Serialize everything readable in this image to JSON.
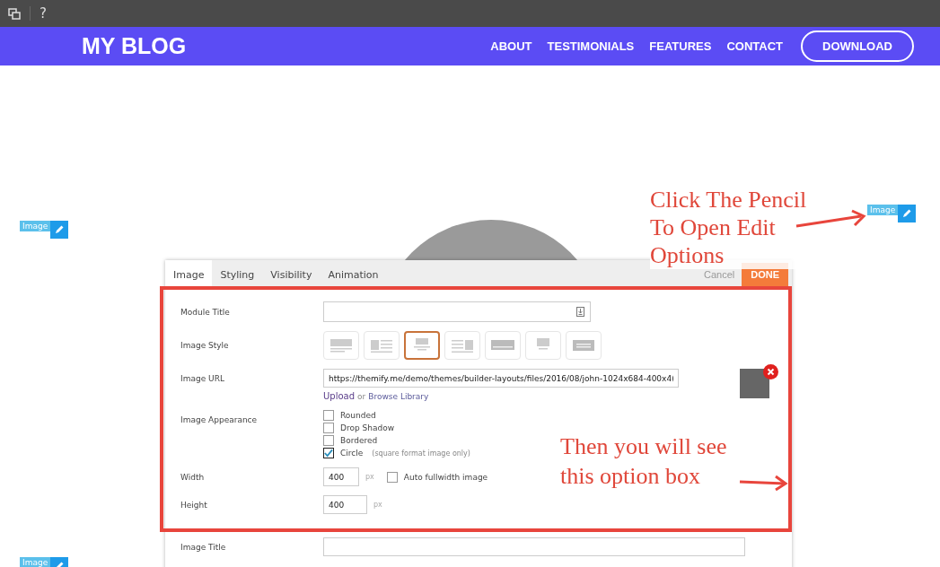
{
  "toolbar": {
    "help": "?"
  },
  "nav": {
    "logo": "MY BLOG",
    "links": [
      "ABOUT",
      "TESTIMONIALS",
      "FEATURES",
      "CONTACT"
    ],
    "button": "DOWNLOAD"
  },
  "module_badges": [
    {
      "label": "Image"
    },
    {
      "label": "Image"
    },
    {
      "label": "Image"
    }
  ],
  "dialog": {
    "tabs": [
      {
        "label": "Image",
        "selected": true
      },
      {
        "label": "Styling",
        "selected": false
      },
      {
        "label": "Visibility",
        "selected": false
      },
      {
        "label": "Animation",
        "selected": false
      }
    ],
    "cancel": "Cancel",
    "done": "DONE",
    "module_title": {
      "label": "Module Title"
    },
    "image_style": {
      "label": "Image Style",
      "options": [
        {
          "kind": "top",
          "selected": false
        },
        {
          "kind": "left",
          "selected": false
        },
        {
          "kind": "center",
          "selected": true
        },
        {
          "kind": "right",
          "selected": false
        },
        {
          "kind": "overlay",
          "selected": false
        },
        {
          "kind": "small",
          "selected": false
        },
        {
          "kind": "banner",
          "selected": false
        }
      ]
    },
    "image_url": {
      "label": "Image URL",
      "value": "https://themify.me/demo/themes/builder-layouts/files/2016/08/john-1024x684-400x4(",
      "upload": "Upload",
      "separator": "or",
      "browse": "Browse Library"
    },
    "appearance": {
      "label": "Image Appearance",
      "options": [
        {
          "label": "Rounded",
          "checked": false
        },
        {
          "label": "Drop Shadow",
          "checked": false
        },
        {
          "label": "Bordered",
          "checked": false
        },
        {
          "label": "Circle",
          "checked": true,
          "note": "(square format image only)"
        }
      ]
    },
    "width": {
      "label": "Width",
      "value": "400",
      "unit": "px",
      "auto": {
        "label": "Auto fullwidth image",
        "checked": false
      }
    },
    "height": {
      "label": "Height",
      "value": "400",
      "unit": "px"
    },
    "image_title": {
      "label": "Image Title"
    }
  },
  "annotations": [
    {
      "lines": [
        "Click The Pencil",
        "To Open Edit",
        "Options"
      ]
    },
    {
      "lines": [
        "Then you will see",
        "this option box"
      ]
    }
  ]
}
